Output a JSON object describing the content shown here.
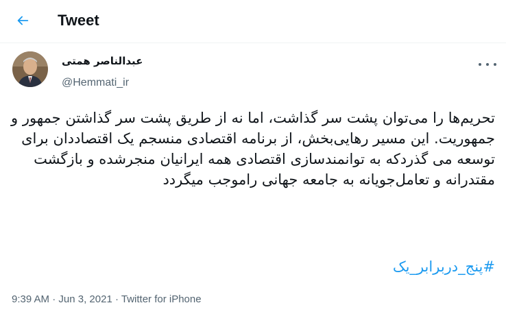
{
  "header": {
    "title": "Tweet",
    "back_icon": "back-arrow-icon",
    "accent_color": "#1d9bf0"
  },
  "author": {
    "display_name": "عبدالناصر همتی",
    "handle": "@Hemmati_ir"
  },
  "tweet": {
    "text": "تحریم‌ها را می‌توان پشت سر گذاشت، اما نه از طریق پشت سر گذاشتن جمهور و جمهوریت. این مسیر رهایی‌بخش، از برنامه اقتصادی منسجم یک اقتصاددان برای توسعه می گذردکه به توانمندسازی اقتصادی همه ایرانیان منجرشده و بازگشت مقتدرانه و تعامل‌جویانه به جامعه جهانی راموجب میگردد",
    "hashtag": "#پنج_دربرابر_یک"
  },
  "meta": {
    "time": "9:39 AM",
    "sep1": " · ",
    "date": "Jun 3, 2021",
    "sep2": " · ",
    "source": "Twitter for iPhone"
  }
}
